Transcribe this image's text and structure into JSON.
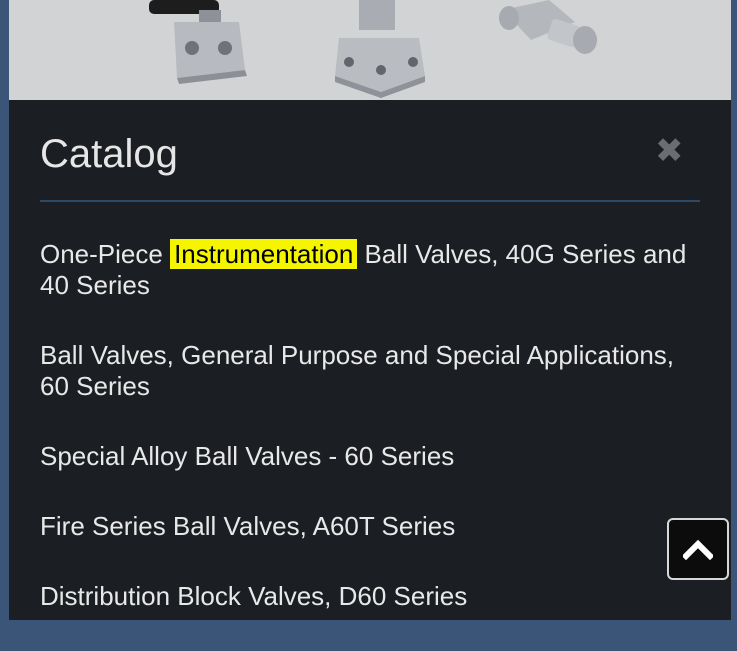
{
  "modal": {
    "title": "Catalog",
    "close_icon": "close-icon"
  },
  "hero": {
    "image": "valve-products-photo"
  },
  "catalog_items": [
    {
      "pre": "One-Piece ",
      "highlight": "Instrumentation",
      "post": " Ball Valves, 40G Series and 40 Series"
    },
    {
      "pre": "Ball Valves, General Purpose and Special Applications, 60 Series",
      "highlight": "",
      "post": ""
    },
    {
      "pre": "Special Alloy Ball Valves - 60 Series",
      "highlight": "",
      "post": ""
    },
    {
      "pre": "Fire Series Ball Valves, A60T Series",
      "highlight": "",
      "post": ""
    },
    {
      "pre": "Distribution Block Valves, D60 Series",
      "highlight": "",
      "post": ""
    }
  ],
  "scroll_top": {
    "icon": "chevron-up-icon"
  },
  "colors": {
    "background": "#1b1e22",
    "highlight": "#f5f500",
    "divider": "#2c4a66"
  }
}
